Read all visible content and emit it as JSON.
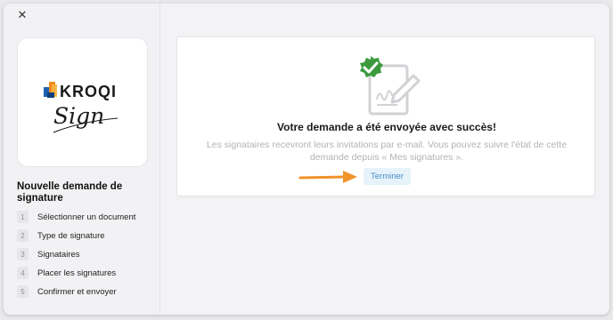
{
  "window": {
    "close_glyph": "✕"
  },
  "sidebar": {
    "logo": {
      "wordmark": "KROQI",
      "tagline": "Sign"
    },
    "wizard_title": "Nouvelle demande de signature",
    "steps": [
      {
        "number": "1",
        "label": "Sélectionner un document"
      },
      {
        "number": "2",
        "label": "Type de signature"
      },
      {
        "number": "3",
        "label": "Signataires"
      },
      {
        "number": "4",
        "label": "Placer les signatures"
      },
      {
        "number": "5",
        "label": "Confirmer et envoyer"
      }
    ]
  },
  "main": {
    "success": {
      "title": "Votre demande a été envoyée avec succès!",
      "message": "Les signataires recevront leurs invitations par e-mail. Vous pouvez suivre l'état de cette demande depuis « Mes signatures ».",
      "finish_button": "Terminer"
    }
  },
  "icons": [
    "close-icon",
    "kroqi-logo-icon",
    "document-signed-icon",
    "check-badge-icon",
    "arrow-right-icon"
  ],
  "colors": {
    "accent_blue": "#4a8ec7",
    "button_bg": "#e6f3fb",
    "success_green": "#3b9a3e",
    "arrow_orange": "#f0932b",
    "logo_blue": "#1e63b0",
    "logo_orange": "#f08a1e"
  }
}
